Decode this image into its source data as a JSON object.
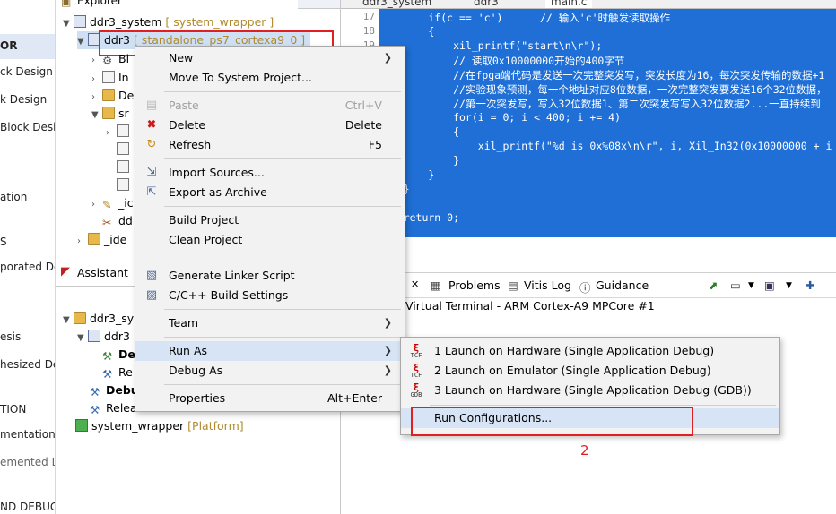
{
  "flow_nav": {
    "items": [
      {
        "label": "OR",
        "bold": true
      },
      {
        "label": "ck Design"
      },
      {
        "label": "k Design"
      },
      {
        "label": "Block Desig"
      },
      {
        "label": "ation"
      },
      {
        "label": "S"
      },
      {
        "label": "porated Des"
      },
      {
        "label": "esis"
      },
      {
        "label": "hesized De"
      },
      {
        "label": "TION"
      },
      {
        "label": "mentation"
      },
      {
        "label": "emented D"
      },
      {
        "label": "ND DEBUG"
      }
    ]
  },
  "explorer": {
    "tab_label": "Explorer",
    "tree": [
      {
        "label": "ddr3_system",
        "decor": "[ system_wrapper ]"
      },
      {
        "label": "ddr3",
        "decor": "[ standalone_ps7_cortexa9_0 ]"
      },
      {
        "label": "Bi"
      },
      {
        "label": "In"
      },
      {
        "label": "De"
      },
      {
        "label": "sr"
      },
      {
        "label": "_ic"
      },
      {
        "label": "dd"
      },
      {
        "label": "_ide"
      }
    ]
  },
  "assistant": {
    "tab_label": "Assistant",
    "tree": [
      {
        "label": "ddr3_sy"
      },
      {
        "label": "ddr3"
      },
      {
        "label": "De"
      },
      {
        "label": "Re"
      },
      {
        "label": "Debu"
      },
      {
        "label": "Relea"
      },
      {
        "label": "system_wrapper",
        "decor": "[Platform]"
      }
    ]
  },
  "editor": {
    "tabs": [
      "ddr3_system",
      "ddr3",
      "main.c"
    ],
    "line_numbers": [
      "17",
      "18",
      "19"
    ],
    "lines": [
      "        if(c == 'c')      // 输入'c'时触发读取操作",
      "        {",
      "            xil_printf(\"start\\n\\r\");",
      "            // 读取0x10000000开始的400字节",
      "            //在fpga端代码是发送一次完整突发写，突发长度为16，每次突发传输的数据+1",
      "            //实验现象预测，每一个地址对应8位数据，一次完整突发要发送16个32位数据，",
      "            //第一次突发写，写入32位数据1、第二次突发写写入32位数据2...一直持续到",
      "            for(i = 0; i < 400; i += 4)",
      "            {",
      "                xil_printf(\"%d is 0x%08x\\n\\r\", i, Xil_In32(0x10000000 + i",
      "            }",
      "        }",
      "    }",
      "",
      "    return 0;"
    ]
  },
  "console": {
    "tabs": [
      "Problems",
      "Vitis Log",
      "Guidance"
    ],
    "title": "Virtual Terminal - ARM Cortex-A9 MPCore #1"
  },
  "context_menu": {
    "items": [
      {
        "label": "New",
        "submenu": true
      },
      {
        "label": "Move To System Project..."
      },
      {
        "label": "Paste",
        "shortcut": "Ctrl+V",
        "disabled": true
      },
      {
        "label": "Delete",
        "shortcut": "Delete",
        "icon": "delete-x-icon"
      },
      {
        "label": "Refresh",
        "shortcut": "F5",
        "icon": "refresh-icon"
      },
      {
        "label": "Import Sources...",
        "icon": "import-icon"
      },
      {
        "label": "Export as Archive",
        "icon": "export-icon"
      },
      {
        "label": "Build Project"
      },
      {
        "label": "Clean Project"
      },
      {
        "label": "Generate Linker Script",
        "icon": "linker-script-icon"
      },
      {
        "label": "C/C++ Build Settings",
        "icon": "build-settings-icon"
      },
      {
        "label": "Team",
        "submenu": true
      },
      {
        "label": "Run As",
        "submenu": true,
        "highlighted": true
      },
      {
        "label": "Debug As",
        "submenu": true
      },
      {
        "label": "Properties",
        "shortcut": "Alt+Enter"
      }
    ]
  },
  "run_as_submenu": {
    "items": [
      {
        "label": "1 Launch on Hardware (Single Application Debug)",
        "icon_top": "ξ",
        "icon_bottom": "TCF"
      },
      {
        "label": "2 Launch on Emulator (Single Application Debug)",
        "icon_top": "ξ",
        "icon_bottom": "TCF"
      },
      {
        "label": "3 Launch on Hardware (Single Application Debug (GDB))",
        "icon_top": "ξ",
        "icon_bottom": "GDB"
      },
      {
        "label": "Run Configurations...",
        "highlighted": true
      }
    ]
  },
  "annotation": {
    "label": "2",
    "color": "#e02020"
  },
  "colors": {
    "editor_selection": "#1f6fd6",
    "menu_highlight": "#d6e4f5",
    "annotation_red": "#e02020"
  }
}
